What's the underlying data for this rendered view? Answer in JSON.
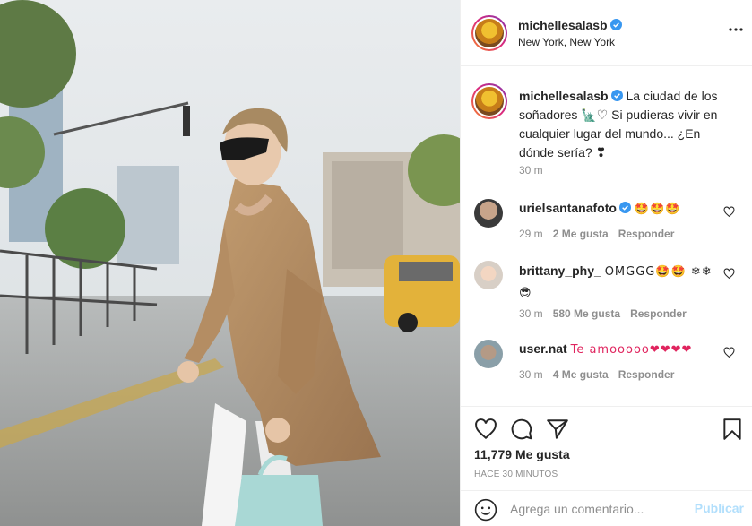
{
  "header": {
    "username": "michellesalasb",
    "location": "New York, New York"
  },
  "caption": {
    "username": "michellesalasb",
    "text": "La ciudad de los soñadores 🗽♡ Si pudieras vivir en cualquier lugar del mundo... ¿En dónde sería? ❣",
    "time": "30 m"
  },
  "comments": [
    {
      "username": "urielsantanafoto",
      "text": "🤩🤩🤩",
      "time": "29 m",
      "likes": "2 Me gusta",
      "reply": "Responder"
    },
    {
      "username": "brittany_phy_",
      "text": "OMGGG🤩🤩 ❄❄😎",
      "time": "30 m",
      "likes": "580 Me gusta",
      "reply": "Responder"
    },
    {
      "username": "user.nat",
      "text": "Te amooooo❤❤❤❤",
      "time": "30 m",
      "likes": "4 Me gusta",
      "reply": "Responder"
    }
  ],
  "stats": {
    "likes": "11,779 Me gusta",
    "ago": "HACE 30 MINUTOS"
  },
  "add_comment": {
    "placeholder": "Agrega un comentario...",
    "publish": "Publicar"
  },
  "icons": {
    "verified": "verified-badge-icon",
    "more": "more-options-icon",
    "like": "heart-icon",
    "comment": "comment-bubble-icon",
    "share": "paper-plane-icon",
    "save": "bookmark-icon",
    "emoji": "smiley-icon"
  },
  "colors": {
    "verified": "#3897f0",
    "publish_disabled": "#b2dffc",
    "muted_text": "#8e8e8e"
  }
}
